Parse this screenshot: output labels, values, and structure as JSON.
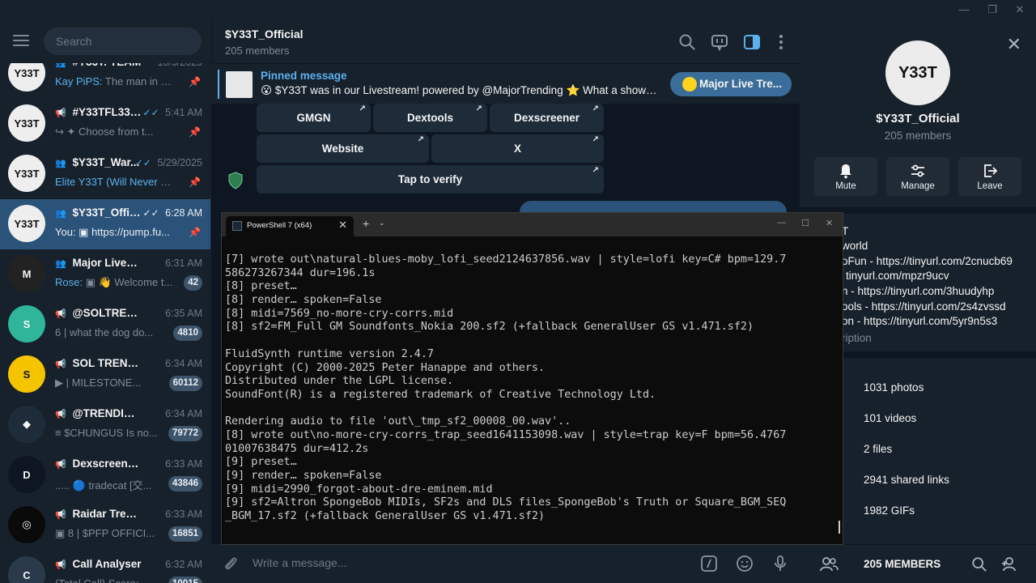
{
  "window": {
    "minimize": "—",
    "maximize": "❐",
    "close": "✕"
  },
  "sidebar": {
    "search_placeholder": "Search",
    "chats": [
      {
        "title": "#Y33T: TEAM",
        "time": "10/3/2025",
        "sender": "Kay PiPS:",
        "preview": " The man in ch...",
        "type": "group",
        "pinned": true,
        "avatar_text": "Y33T",
        "avatar_bg": "#eeeeee"
      },
      {
        "title": "#Y33TFL33K_...",
        "time": "5:41 AM",
        "sender": "",
        "preview": "↪ ✦ Choose from t...",
        "type": "channel",
        "pinned": true,
        "check": "✓✓",
        "avatar_text": "Y33T",
        "avatar_bg": "#eeeeee"
      },
      {
        "title": "$Y33T_War...",
        "time": "5/29/2025",
        "sender": "Elite Y33T (Will Never D...",
        "preview": "",
        "type": "group",
        "pinned": true,
        "check": "✓✓",
        "avatar_text": "Y33T",
        "avatar_bg": "#eeeeee"
      },
      {
        "title": "$Y33T_Official",
        "time": "6:28 AM",
        "sender": "You:",
        "preview": " ▣ https://pump.fu...",
        "type": "group",
        "pinned": true,
        "check": "✓✓",
        "active": true,
        "avatar_text": "Y33T",
        "avatar_bg": "#eeeeee"
      },
      {
        "title": "Major Livestrea...",
        "time": "6:31 AM",
        "sender": "Rose:",
        "preview": " ▣ 👋 Welcome t...",
        "type": "group",
        "badge": "42",
        "avatar_text": "M",
        "avatar_bg": "#222222"
      },
      {
        "title": "@SOLTRENDING...",
        "time": "6:35 AM",
        "sender": "",
        "preview": "6 | what the dog do...",
        "type": "channel",
        "badge": "4810",
        "avatar_text": "S",
        "avatar_bg": "#2fb59a"
      },
      {
        "title": "SOL TRENDING ...",
        "time": "6:34 AM",
        "sender": "",
        "preview": "▶  | MILESTONE...",
        "type": "channel",
        "badge": "60112",
        "avatar_text": "S",
        "avatar_bg": "#f5c400"
      },
      {
        "title": "@TRENDING (ET...",
        "time": "6:34 AM",
        "sender": "",
        "preview": "≡ $CHUNGUS Is no...",
        "type": "channel",
        "badge": "79772",
        "avatar_text": "◆",
        "avatar_bg": "#1e2c3a"
      },
      {
        "title": "Dexscreener Up...",
        "time": "6:33 AM",
        "sender": "",
        "preview": "..... 🔵 tradecat [交...",
        "type": "channel",
        "badge": "43846",
        "avatar_text": "D",
        "avatar_bg": "#0e1621"
      },
      {
        "title": "Raidar Trending",
        "time": "6:33 AM",
        "sender": "",
        "preview": "▣ 8 | $PFP OFFICI...",
        "type": "channel",
        "badge": "16851",
        "avatar_text": "◎",
        "avatar_bg": "#0a0a0a"
      },
      {
        "title": "Call Analyser",
        "time": "6:32 AM",
        "sender": "",
        "preview": "(Total Call) Score:...",
        "type": "channel",
        "badge": "10015",
        "avatar_text": "C",
        "avatar_bg": "#2a3a4a"
      }
    ]
  },
  "header": {
    "title": "$Y33T_Official",
    "subtitle": "205 members"
  },
  "pinned": {
    "label": "Pinned message",
    "text": "😮 $Y33T was in our Livestream! powered by @MajorTrending ⭐ What a show! ...",
    "button": "Major Live Tre..."
  },
  "keyboard": {
    "buttons": [
      "GMGN",
      "Dextools",
      "Dexscreener",
      "Website",
      "X",
      "Tap to verify"
    ],
    "arrow": "↗"
  },
  "composer": {
    "placeholder": "Write a message..."
  },
  "right_panel": {
    "title": "$Y33T_Official",
    "subtitle": "205 members",
    "actions": [
      "Mute",
      "Manage",
      "Leave"
    ],
    "description": [
      "T",
      "world",
      "oFun - https://tinyurl.com/2cnucb69",
      "tinyurl.com/mpzr9ucv",
      "n - https://tinyurl.com/3huudyhp",
      "ools - https://tinyurl.com/2s4zvssd",
      "on - https://tinyurl.com/5yr9n5s3",
      "ription"
    ],
    "media": [
      "1031 photos",
      "101 videos",
      "2 files",
      "2941 shared links",
      "1982 GIFs"
    ],
    "footer_label": "205 MEMBERS"
  },
  "terminal": {
    "tab_title": "PowerShell 7 (x64)",
    "lines": [
      "[7] wrote out\\natural-blues-moby_lofi_seed2124637856.wav | style=lofi key=C# bpm=129.7",
      "586273267344 dur=196.1s",
      "[8] preset…",
      "[8] render… spoken=False",
      "[8] midi=7569_no-more-cry-corrs.mid",
      "[8] sf2=FM_Full GM Soundfonts_Nokia 200.sf2 (+fallback GeneralUser GS v1.471.sf2)",
      "",
      "FluidSynth runtime version 2.4.7",
      "Copyright (C) 2000-2025 Peter Hanappe and others.",
      "Distributed under the LGPL license.",
      "SoundFont(R) is a registered trademark of Creative Technology Ltd.",
      "",
      "Rendering audio to file 'out\\_tmp_sf2_00008_00.wav'..",
      "[8] wrote out\\no-more-cry-corrs_trap_seed1641153098.wav | style=trap key=F bpm=56.4767",
      "01007638475 dur=412.2s",
      "[9] preset…",
      "[9] render… spoken=False",
      "[9] midi=2990_forgot-about-dre-eminem.mid",
      "[9] sf2=Altron SpongeBob MIDIs, SF2s and DLS files_SpongeBob's Truth or Square_BGM_SEQ",
      "_BGM_17.sf2 (+fallback GeneralUser GS v1.471.sf2)"
    ]
  },
  "colors": {
    "accent": "#5bb1ee",
    "active": "#2b5278",
    "bg": "#17212b",
    "chat_bg": "#0e1621"
  }
}
